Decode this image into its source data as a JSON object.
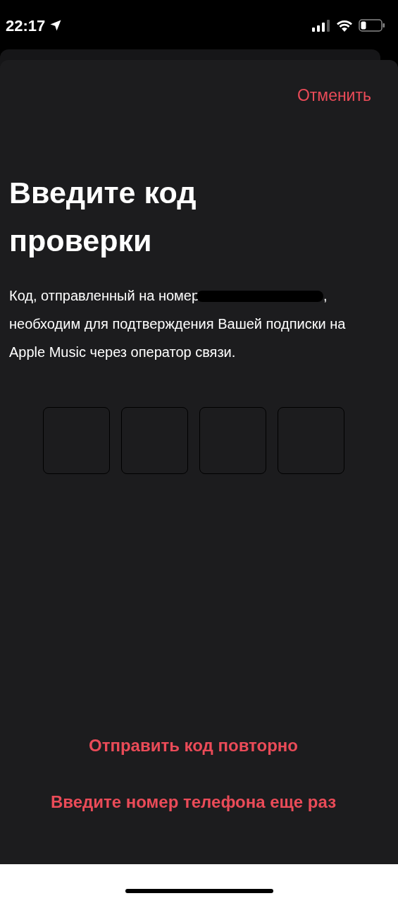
{
  "status_bar": {
    "time": "22:17"
  },
  "sheet": {
    "cancel": "Отменить",
    "title": "Введите код проверки",
    "description_before": "Код, отправленный на номер",
    "description_after": ", необходим для подтверждения Вашей подписки на Apple Music через оператор связи.",
    "code_fields": [
      {
        "kind": "digit"
      },
      {
        "kind": "digit"
      },
      {
        "kind": "digit"
      },
      {
        "kind": "digit"
      }
    ],
    "links": [
      "Отправить код повторно",
      "Введите номер телефона еще раз"
    ]
  }
}
